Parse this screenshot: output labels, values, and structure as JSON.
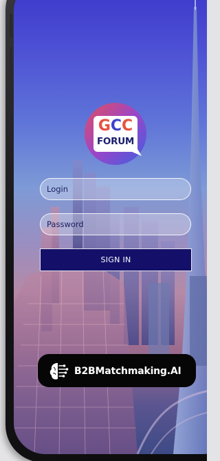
{
  "logo": {
    "line1_g": "G",
    "line1_c1": "C",
    "line1_c2": "C",
    "line2": "FORUM"
  },
  "login_form": {
    "login_placeholder": "Login",
    "password_placeholder": "Password",
    "signin_label": "SIGN IN"
  },
  "badge": {
    "label": "B2BMatchmaking.AI",
    "icon": "brain-circuit-icon"
  },
  "colors": {
    "logo_red": "#e8503f",
    "logo_blue": "#3c42c8",
    "logo_navy": "#1b1f6b",
    "button_bg": "#14106a",
    "badge_bg": "#060606"
  }
}
